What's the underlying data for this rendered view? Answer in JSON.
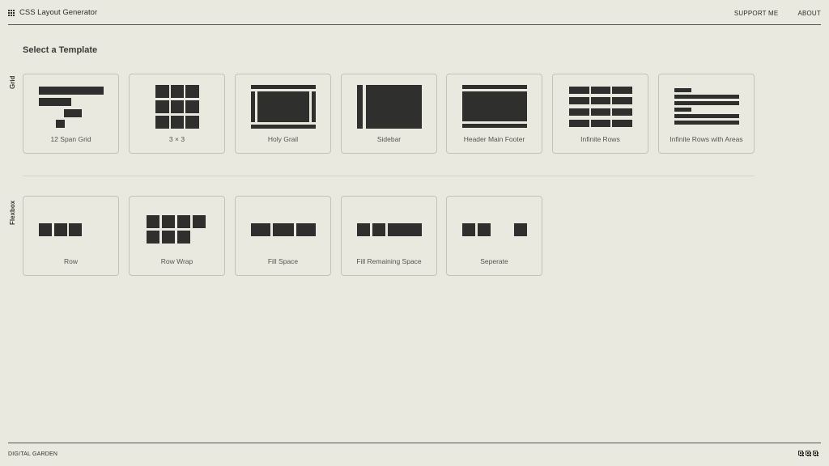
{
  "header": {
    "app_title": "CSS Layout Generator",
    "nav": [
      "SUPPORT ME",
      "ABOUT"
    ]
  },
  "main": {
    "title": "Select a Template",
    "sections": [
      {
        "label": "Grid",
        "templates": [
          "12 Span Grid",
          "3 × 3",
          "Holy Grail",
          "Sidebar",
          "Header Main Footer",
          "Infinite Rows",
          "Infinite Rows with Areas"
        ]
      },
      {
        "label": "Flexbox",
        "templates": [
          "Row",
          "Row Wrap",
          "Fill Space",
          "Fill Remaining Space",
          "Seperate"
        ]
      }
    ]
  },
  "footer": {
    "label": "DIGITAL GARDEN"
  }
}
